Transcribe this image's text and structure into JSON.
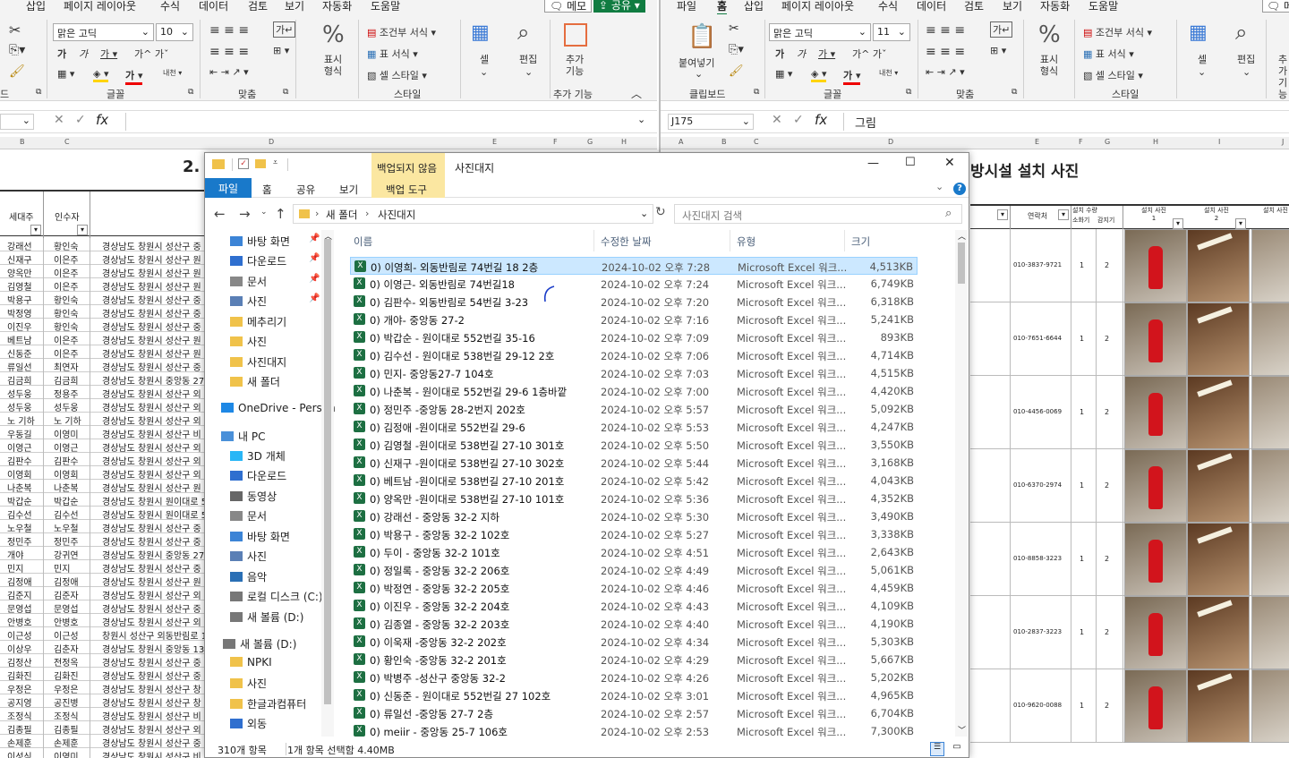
{
  "left_excel": {
    "menu": [
      "삽입",
      "페이지 레이아웃",
      "수식",
      "데이터",
      "검토",
      "보기",
      "자동화",
      "도움말"
    ],
    "memo_button": "메모",
    "share_button": "공유",
    "font_name": "맑은 고딕",
    "font_size": "10",
    "groups": [
      "글꼴",
      "맞춤",
      "스타일",
      "추가 기능"
    ],
    "group_fragment": "드",
    "styles": [
      "조건부 서식",
      "표 서식",
      "셀 스타일"
    ],
    "number_format": "표시 형식",
    "cell_label": "셀",
    "edit_label": "편집",
    "addin_label": "추가 기능",
    "columns": [
      "B",
      "C",
      "D",
      "E",
      "F",
      "G",
      "H"
    ],
    "title_fragment": "2.",
    "headers": {
      "household": "세대주",
      "receiver": "인수자"
    },
    "rows": [
      [
        "강래선",
        "황인숙",
        "경상남도 창원시 성산구 중"
      ],
      [
        "신재구",
        "이은주",
        "경상남도 창원시 성산구 원"
      ],
      [
        "양옥만",
        "이은주",
        "경상남도 창원시 성산구 원"
      ],
      [
        "김영철",
        "이은주",
        "경상남도 창원시 성산구 원"
      ],
      [
        "박용구",
        "황인숙",
        "경상남도 창원시 성산구 중"
      ],
      [
        "박정영",
        "황인숙",
        "경상남도 창원시 성산구 중"
      ],
      [
        "이진우",
        "황인숙",
        "경상남도 창원시 성산구 중"
      ],
      [
        "베트남",
        "이은주",
        "경상남도 창원시 성산구 원"
      ],
      [
        "신동준",
        "이은주",
        "경상남도 창원시 성산구 원"
      ],
      [
        "류일선",
        "최연자",
        "경상남도 창원시 성산구 중"
      ],
      [
        "김금희",
        "김금희",
        "경상남도 창원시 중앙동 27"
      ],
      [
        "성두웅",
        "정용주",
        "경상남도 창원시 성산구 외"
      ],
      [
        "성두웅",
        "성두웅",
        "경상남도 창원시 성산구 외"
      ],
      [
        "노 기하",
        "노 기하",
        "경상남도 창원시 성산구 외"
      ],
      [
        "우동길",
        "이영미",
        "경상남도 창원시 성산구 비"
      ],
      [
        "이영근",
        "이영근",
        "경상남도 창원시 성산구 외"
      ],
      [
        "김판수",
        "김판수",
        "경상남도 창원시 성산구 외"
      ],
      [
        "이영회",
        "이영회",
        "경상남도 창원시 성산구 외"
      ],
      [
        "나춘복",
        "나춘복",
        "경상남도 창원시 성산구 원"
      ],
      [
        "박갑순",
        "박갑순",
        "경상남도 창원시 원이대로 5"
      ],
      [
        "김수선",
        "김수선",
        "경상남도 창원시 원이대로 5"
      ],
      [
        "노우철",
        "노우철",
        "경상남도 창원시 성산구 중"
      ],
      [
        "정민주",
        "정민주",
        "경상남도 창원시 성산구 중"
      ],
      [
        "개야",
        "강귀연",
        "경상남도 창원시 중앙동 27-"
      ],
      [
        "민지",
        "민지",
        "경상남도 창원시 성산구 중"
      ],
      [
        "김정애",
        "김정애",
        "경상남도 창원시 성산구 원"
      ],
      [
        "김준지",
        "김준자",
        "경상남도 창원시 성산구 외"
      ],
      [
        "문영섭",
        "문영섭",
        "경상남도 창원시 성산구 중"
      ],
      [
        "안병호",
        "안병호",
        "경상남도 창원시 성산구 외"
      ],
      [
        "이근성",
        "이근성",
        "창원시 성산구 외동반림로 1"
      ],
      [
        "이상우",
        "김춘자",
        "경상남도 창원시 중앙동 13"
      ],
      [
        "김정산",
        "전정옥",
        "경상남도 창원시 성산구 중"
      ],
      [
        "김화진",
        "김화진",
        "경상남도 창원시 성산구 중"
      ],
      [
        "우정은",
        "우정은",
        "경상남도 창원시 성산구 창"
      ],
      [
        "공지영",
        "공진병",
        "경상남도 창원시 성산구 창"
      ],
      [
        "조정식",
        "조정식",
        "경상남도 창원시 성산구 비"
      ],
      [
        "김종필",
        "김종필",
        "경상남도 창원시 성산구 외"
      ],
      [
        "손제훈",
        "손제훈",
        "경상남도 창원시 성산구 중"
      ],
      [
        "이성식",
        "이영미",
        "경상남도 창원시 성산구 비"
      ]
    ]
  },
  "right_excel": {
    "menu": [
      "파일",
      "홈",
      "삽입",
      "페이지 레이아웃",
      "수식",
      "데이터",
      "검토",
      "보기",
      "자동화",
      "도움말"
    ],
    "memo_fragment": "메",
    "font_name": "맑은 고딕",
    "font_size": "11",
    "paste_label": "붙여넣기",
    "groups": [
      "클립보드",
      "글꼴",
      "맞춤",
      "표시 형식",
      "스타일",
      "셀",
      "편집",
      "추가"
    ],
    "styles": [
      "조건부 서식",
      "표 서식",
      "셀 스타일"
    ],
    "number_format": "표시 형식",
    "cell_label": "셀",
    "edit_label": "편집",
    "addin_fragment": "추가 기능",
    "name_box": "J175",
    "formula": "그림",
    "columns": [
      "A",
      "B",
      "C",
      "D",
      "E",
      "F",
      "G",
      "H",
      "I",
      "J"
    ],
    "title": "방시설 설치 사진",
    "headers": {
      "contact": "연락처",
      "install_qty": "설치 수량",
      "extinguisher": "소화기",
      "detector": "감지기",
      "photo1": "설치 사진 1",
      "photo2": "설치 사진 2",
      "photo3": "설치 사진"
    },
    "rows": [
      {
        "phone": "010-3837-9721",
        "qty1": "1",
        "qty2": "2"
      },
      {
        "phone": "010-7651-6644",
        "qty1": "1",
        "qty2": "2"
      },
      {
        "phone": "010-4456-0069",
        "qty1": "1",
        "qty2": "2"
      },
      {
        "phone": "010-6370-2974",
        "qty1": "1",
        "qty2": "2"
      },
      {
        "phone": "010-8858-3223",
        "qty1": "1",
        "qty2": "2"
      },
      {
        "phone": "010-2837-3223",
        "qty1": "1",
        "qty2": "2"
      },
      {
        "phone": "010-9620-0088",
        "qty1": "1",
        "qty2": "2"
      }
    ]
  },
  "explorer": {
    "title": "사진대지",
    "backup_status": "백업되지 않음",
    "tabs": [
      "파일",
      "홈",
      "공유",
      "보기"
    ],
    "backup_tool": "백업 도구",
    "breadcrumb": [
      "새 폴더",
      "사진대지"
    ],
    "search_placeholder": "사진대지 검색",
    "nav": [
      {
        "label": "바탕 화면",
        "pin": true,
        "type": "desktop"
      },
      {
        "label": "다운로드",
        "pin": true,
        "type": "download"
      },
      {
        "label": "문서",
        "pin": true,
        "type": "doc"
      },
      {
        "label": "사진",
        "pin": true,
        "type": "pic"
      },
      {
        "label": "메추리기",
        "pin": false,
        "type": "folder"
      },
      {
        "label": "사진",
        "pin": false,
        "type": "folder"
      },
      {
        "label": "사진대지",
        "pin": false,
        "type": "folder"
      },
      {
        "label": "새 폴더",
        "pin": false,
        "type": "folder"
      },
      {
        "label": "OneDrive - Person",
        "pin": false,
        "type": "cloud"
      },
      {
        "label": "내 PC",
        "pin": false,
        "type": "pc"
      },
      {
        "label": "3D 개체",
        "pin": false,
        "type": "3d"
      },
      {
        "label": "다운로드",
        "pin": false,
        "type": "download"
      },
      {
        "label": "동영상",
        "pin": false,
        "type": "video"
      },
      {
        "label": "문서",
        "pin": false,
        "type": "doc"
      },
      {
        "label": "바탕 화면",
        "pin": false,
        "type": "desktop"
      },
      {
        "label": "사진",
        "pin": false,
        "type": "pic"
      },
      {
        "label": "음악",
        "pin": false,
        "type": "music"
      },
      {
        "label": "로컬 디스크 (C:)",
        "pin": false,
        "type": "disk"
      },
      {
        "label": "새 볼륨 (D:)",
        "pin": false,
        "type": "disk"
      },
      {
        "label": "새 볼륨 (D:)",
        "pin": false,
        "type": "disk"
      },
      {
        "label": "NPKI",
        "pin": false,
        "type": "folder"
      },
      {
        "label": "사진",
        "pin": false,
        "type": "folder"
      },
      {
        "label": "한글과컴퓨터",
        "pin": false,
        "type": "folder"
      },
      {
        "label": "외동",
        "pin": false,
        "type": "net"
      }
    ],
    "columns": [
      "이름",
      "수정한 날짜",
      "유형",
      "크기"
    ],
    "files": [
      {
        "name": "0) 이영희-  외동반림로 74번길 18 2층",
        "date": "2024-10-02 오후 7:28",
        "type": "Microsoft Excel 워크...",
        "size": "4,513KB"
      },
      {
        "name": "0) 이영근-  외동반림로 74번길18",
        "date": "2024-10-02 오후 7:24",
        "type": "Microsoft Excel 워크...",
        "size": "6,749KB"
      },
      {
        "name": "0) 김판수-  외동반림로 54번길 3-23",
        "date": "2024-10-02 오후 7:20",
        "type": "Microsoft Excel 워크...",
        "size": "6,318KB"
      },
      {
        "name": "0) 개야-  중앙동 27-2",
        "date": "2024-10-02 오후 7:16",
        "type": "Microsoft Excel 워크...",
        "size": "5,241KB"
      },
      {
        "name": "0) 박갑순 - 원이대로 552번길 35-16",
        "date": "2024-10-02 오후 7:09",
        "type": "Microsoft Excel 워크...",
        "size": "893KB"
      },
      {
        "name": "0) 김수선 - 원이대로 538번길 29-12 2호",
        "date": "2024-10-02 오후 7:06",
        "type": "Microsoft Excel 워크...",
        "size": "4,714KB"
      },
      {
        "name": "0) 민지-  중앙동27-7 104호",
        "date": "2024-10-02 오후 7:03",
        "type": "Microsoft Excel 워크...",
        "size": "4,515KB"
      },
      {
        "name": "0) 나춘복 - 원이대로 552번길 29-6 1층바깥",
        "date": "2024-10-02 오후 7:00",
        "type": "Microsoft Excel 워크...",
        "size": "4,420KB"
      },
      {
        "name": "0) 정민주 -중앙동 28-2번지 202호",
        "date": "2024-10-02 오후 5:57",
        "type": "Microsoft Excel 워크...",
        "size": "5,092KB"
      },
      {
        "name": "0) 김정애 -원이대로 552번길 29-6",
        "date": "2024-10-02 오후 5:53",
        "type": "Microsoft Excel 워크...",
        "size": "4,247KB"
      },
      {
        "name": "0) 김영철 -원이대로 538번길 27-10 301호",
        "date": "2024-10-02 오후 5:50",
        "type": "Microsoft Excel 워크...",
        "size": "3,550KB"
      },
      {
        "name": "0) 신재구 -원이대로 538번길 27-10 302호",
        "date": "2024-10-02 오후 5:44",
        "type": "Microsoft Excel 워크...",
        "size": "3,168KB"
      },
      {
        "name": "0) 베트남 -원이대로 538번길 27-10 201호",
        "date": "2024-10-02 오후 5:42",
        "type": "Microsoft Excel 워크...",
        "size": "4,043KB"
      },
      {
        "name": "0) 양옥만 -원이대로 538번길 27-10 101호",
        "date": "2024-10-02 오후 5:36",
        "type": "Microsoft Excel 워크...",
        "size": "4,352KB"
      },
      {
        "name": "0) 강래선 -  중앙동 32-2 지하",
        "date": "2024-10-02 오후 5:30",
        "type": "Microsoft Excel 워크...",
        "size": "3,490KB"
      },
      {
        "name": "0) 박용구 -  중앙동 32-2 102호",
        "date": "2024-10-02 오후 5:27",
        "type": "Microsoft Excel 워크...",
        "size": "3,338KB"
      },
      {
        "name": "0) 두이 -  중앙동 32-2 101호",
        "date": "2024-10-02 오후 4:51",
        "type": "Microsoft Excel 워크...",
        "size": "2,643KB"
      },
      {
        "name": "0) 정일록 -  중앙동 32-2 206호",
        "date": "2024-10-02 오후 4:49",
        "type": "Microsoft Excel 워크...",
        "size": "5,061KB"
      },
      {
        "name": "0) 박정연 - 중앙동 32-2 205호",
        "date": "2024-10-02 오후 4:46",
        "type": "Microsoft Excel 워크...",
        "size": "4,459KB"
      },
      {
        "name": "0) 이진우 - 중앙동 32-2 204호",
        "date": "2024-10-02 오후 4:43",
        "type": "Microsoft Excel 워크...",
        "size": "4,109KB"
      },
      {
        "name": "0) 김종열 - 중앙동 32-2 203호",
        "date": "2024-10-02 오후 4:40",
        "type": "Microsoft Excel 워크...",
        "size": "4,190KB"
      },
      {
        "name": "0) 이욱재 -중앙동 32-2 202호",
        "date": "2024-10-02 오후 4:34",
        "type": "Microsoft Excel 워크...",
        "size": "5,303KB"
      },
      {
        "name": "0) 황인숙 -중앙동 32-2 201호",
        "date": "2024-10-02 오후 4:29",
        "type": "Microsoft Excel 워크...",
        "size": "5,667KB"
      },
      {
        "name": "0) 박병주 -성산구 중앙동 32-2",
        "date": "2024-10-02 오후 4:26",
        "type": "Microsoft Excel 워크...",
        "size": "5,202KB"
      },
      {
        "name": "0) 신동준 - 원이대로 552번길 27 102호",
        "date": "2024-10-02 오후 3:01",
        "type": "Microsoft Excel 워크...",
        "size": "4,965KB"
      },
      {
        "name": "0) 류일선 -중앙동 27-7 2층",
        "date": "2024-10-02 오후 2:57",
        "type": "Microsoft Excel 워크...",
        "size": "6,704KB"
      },
      {
        "name": "0) meiir - 중앙동 25-7 106호",
        "date": "2024-10-02 오후 2:53",
        "type": "Microsoft Excel 워크...",
        "size": "7,300KB"
      }
    ],
    "status_count": "310개 항목",
    "status_selected": "1개 항목 선택함 4.40MB",
    "colors": {
      "selected_row": "#cce8ff",
      "ribbon_tab": "#1979ca",
      "backup_badge": "#fbe7a1",
      "excel_icon": "#1d6f42"
    }
  }
}
